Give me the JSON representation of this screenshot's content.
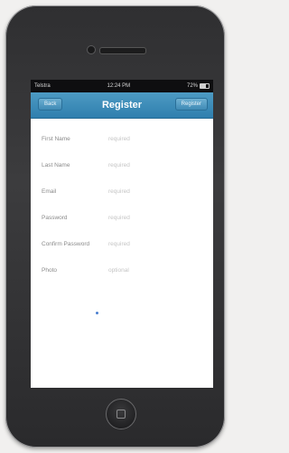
{
  "status_bar": {
    "carrier": "Telstra",
    "time": "12:24 PM",
    "battery": "72%"
  },
  "nav": {
    "back_label": "Back",
    "title": "Register",
    "register_label": "Register"
  },
  "form": {
    "fields": [
      {
        "label": "First Name",
        "placeholder": "required"
      },
      {
        "label": "Last Name",
        "placeholder": "required"
      },
      {
        "label": "Email",
        "placeholder": "required"
      },
      {
        "label": "Password",
        "placeholder": "required"
      },
      {
        "label": "Confirm Password",
        "placeholder": "required"
      },
      {
        "label": "Photo",
        "placeholder": "optional"
      }
    ]
  }
}
